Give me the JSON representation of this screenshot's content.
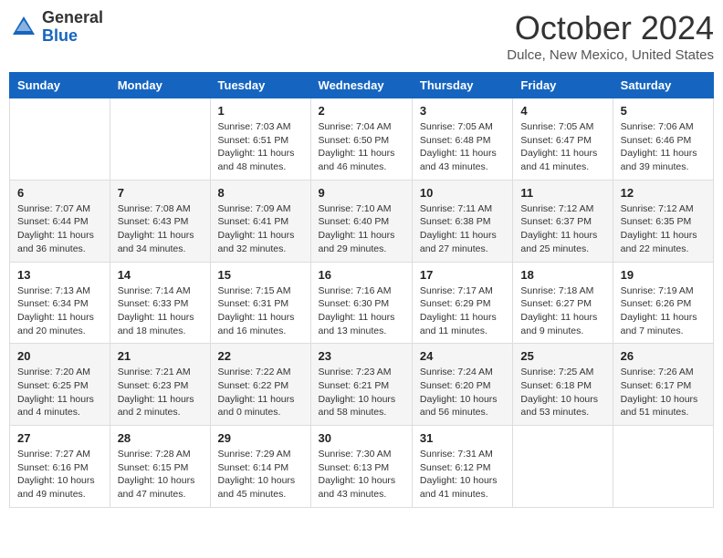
{
  "header": {
    "logo_general": "General",
    "logo_blue": "Blue",
    "month_title": "October 2024",
    "location": "Dulce, New Mexico, United States"
  },
  "days_of_week": [
    "Sunday",
    "Monday",
    "Tuesday",
    "Wednesday",
    "Thursday",
    "Friday",
    "Saturday"
  ],
  "weeks": [
    [
      {
        "num": "",
        "sunrise": "",
        "sunset": "",
        "daylight": ""
      },
      {
        "num": "",
        "sunrise": "",
        "sunset": "",
        "daylight": ""
      },
      {
        "num": "1",
        "sunrise": "Sunrise: 7:03 AM",
        "sunset": "Sunset: 6:51 PM",
        "daylight": "Daylight: 11 hours and 48 minutes."
      },
      {
        "num": "2",
        "sunrise": "Sunrise: 7:04 AM",
        "sunset": "Sunset: 6:50 PM",
        "daylight": "Daylight: 11 hours and 46 minutes."
      },
      {
        "num": "3",
        "sunrise": "Sunrise: 7:05 AM",
        "sunset": "Sunset: 6:48 PM",
        "daylight": "Daylight: 11 hours and 43 minutes."
      },
      {
        "num": "4",
        "sunrise": "Sunrise: 7:05 AM",
        "sunset": "Sunset: 6:47 PM",
        "daylight": "Daylight: 11 hours and 41 minutes."
      },
      {
        "num": "5",
        "sunrise": "Sunrise: 7:06 AM",
        "sunset": "Sunset: 6:46 PM",
        "daylight": "Daylight: 11 hours and 39 minutes."
      }
    ],
    [
      {
        "num": "6",
        "sunrise": "Sunrise: 7:07 AM",
        "sunset": "Sunset: 6:44 PM",
        "daylight": "Daylight: 11 hours and 36 minutes."
      },
      {
        "num": "7",
        "sunrise": "Sunrise: 7:08 AM",
        "sunset": "Sunset: 6:43 PM",
        "daylight": "Daylight: 11 hours and 34 minutes."
      },
      {
        "num": "8",
        "sunrise": "Sunrise: 7:09 AM",
        "sunset": "Sunset: 6:41 PM",
        "daylight": "Daylight: 11 hours and 32 minutes."
      },
      {
        "num": "9",
        "sunrise": "Sunrise: 7:10 AM",
        "sunset": "Sunset: 6:40 PM",
        "daylight": "Daylight: 11 hours and 29 minutes."
      },
      {
        "num": "10",
        "sunrise": "Sunrise: 7:11 AM",
        "sunset": "Sunset: 6:38 PM",
        "daylight": "Daylight: 11 hours and 27 minutes."
      },
      {
        "num": "11",
        "sunrise": "Sunrise: 7:12 AM",
        "sunset": "Sunset: 6:37 PM",
        "daylight": "Daylight: 11 hours and 25 minutes."
      },
      {
        "num": "12",
        "sunrise": "Sunrise: 7:12 AM",
        "sunset": "Sunset: 6:35 PM",
        "daylight": "Daylight: 11 hours and 22 minutes."
      }
    ],
    [
      {
        "num": "13",
        "sunrise": "Sunrise: 7:13 AM",
        "sunset": "Sunset: 6:34 PM",
        "daylight": "Daylight: 11 hours and 20 minutes."
      },
      {
        "num": "14",
        "sunrise": "Sunrise: 7:14 AM",
        "sunset": "Sunset: 6:33 PM",
        "daylight": "Daylight: 11 hours and 18 minutes."
      },
      {
        "num": "15",
        "sunrise": "Sunrise: 7:15 AM",
        "sunset": "Sunset: 6:31 PM",
        "daylight": "Daylight: 11 hours and 16 minutes."
      },
      {
        "num": "16",
        "sunrise": "Sunrise: 7:16 AM",
        "sunset": "Sunset: 6:30 PM",
        "daylight": "Daylight: 11 hours and 13 minutes."
      },
      {
        "num": "17",
        "sunrise": "Sunrise: 7:17 AM",
        "sunset": "Sunset: 6:29 PM",
        "daylight": "Daylight: 11 hours and 11 minutes."
      },
      {
        "num": "18",
        "sunrise": "Sunrise: 7:18 AM",
        "sunset": "Sunset: 6:27 PM",
        "daylight": "Daylight: 11 hours and 9 minutes."
      },
      {
        "num": "19",
        "sunrise": "Sunrise: 7:19 AM",
        "sunset": "Sunset: 6:26 PM",
        "daylight": "Daylight: 11 hours and 7 minutes."
      }
    ],
    [
      {
        "num": "20",
        "sunrise": "Sunrise: 7:20 AM",
        "sunset": "Sunset: 6:25 PM",
        "daylight": "Daylight: 11 hours and 4 minutes."
      },
      {
        "num": "21",
        "sunrise": "Sunrise: 7:21 AM",
        "sunset": "Sunset: 6:23 PM",
        "daylight": "Daylight: 11 hours and 2 minutes."
      },
      {
        "num": "22",
        "sunrise": "Sunrise: 7:22 AM",
        "sunset": "Sunset: 6:22 PM",
        "daylight": "Daylight: 11 hours and 0 minutes."
      },
      {
        "num": "23",
        "sunrise": "Sunrise: 7:23 AM",
        "sunset": "Sunset: 6:21 PM",
        "daylight": "Daylight: 10 hours and 58 minutes."
      },
      {
        "num": "24",
        "sunrise": "Sunrise: 7:24 AM",
        "sunset": "Sunset: 6:20 PM",
        "daylight": "Daylight: 10 hours and 56 minutes."
      },
      {
        "num": "25",
        "sunrise": "Sunrise: 7:25 AM",
        "sunset": "Sunset: 6:18 PM",
        "daylight": "Daylight: 10 hours and 53 minutes."
      },
      {
        "num": "26",
        "sunrise": "Sunrise: 7:26 AM",
        "sunset": "Sunset: 6:17 PM",
        "daylight": "Daylight: 10 hours and 51 minutes."
      }
    ],
    [
      {
        "num": "27",
        "sunrise": "Sunrise: 7:27 AM",
        "sunset": "Sunset: 6:16 PM",
        "daylight": "Daylight: 10 hours and 49 minutes."
      },
      {
        "num": "28",
        "sunrise": "Sunrise: 7:28 AM",
        "sunset": "Sunset: 6:15 PM",
        "daylight": "Daylight: 10 hours and 47 minutes."
      },
      {
        "num": "29",
        "sunrise": "Sunrise: 7:29 AM",
        "sunset": "Sunset: 6:14 PM",
        "daylight": "Daylight: 10 hours and 45 minutes."
      },
      {
        "num": "30",
        "sunrise": "Sunrise: 7:30 AM",
        "sunset": "Sunset: 6:13 PM",
        "daylight": "Daylight: 10 hours and 43 minutes."
      },
      {
        "num": "31",
        "sunrise": "Sunrise: 7:31 AM",
        "sunset": "Sunset: 6:12 PM",
        "daylight": "Daylight: 10 hours and 41 minutes."
      },
      {
        "num": "",
        "sunrise": "",
        "sunset": "",
        "daylight": ""
      },
      {
        "num": "",
        "sunrise": "",
        "sunset": "",
        "daylight": ""
      }
    ]
  ]
}
